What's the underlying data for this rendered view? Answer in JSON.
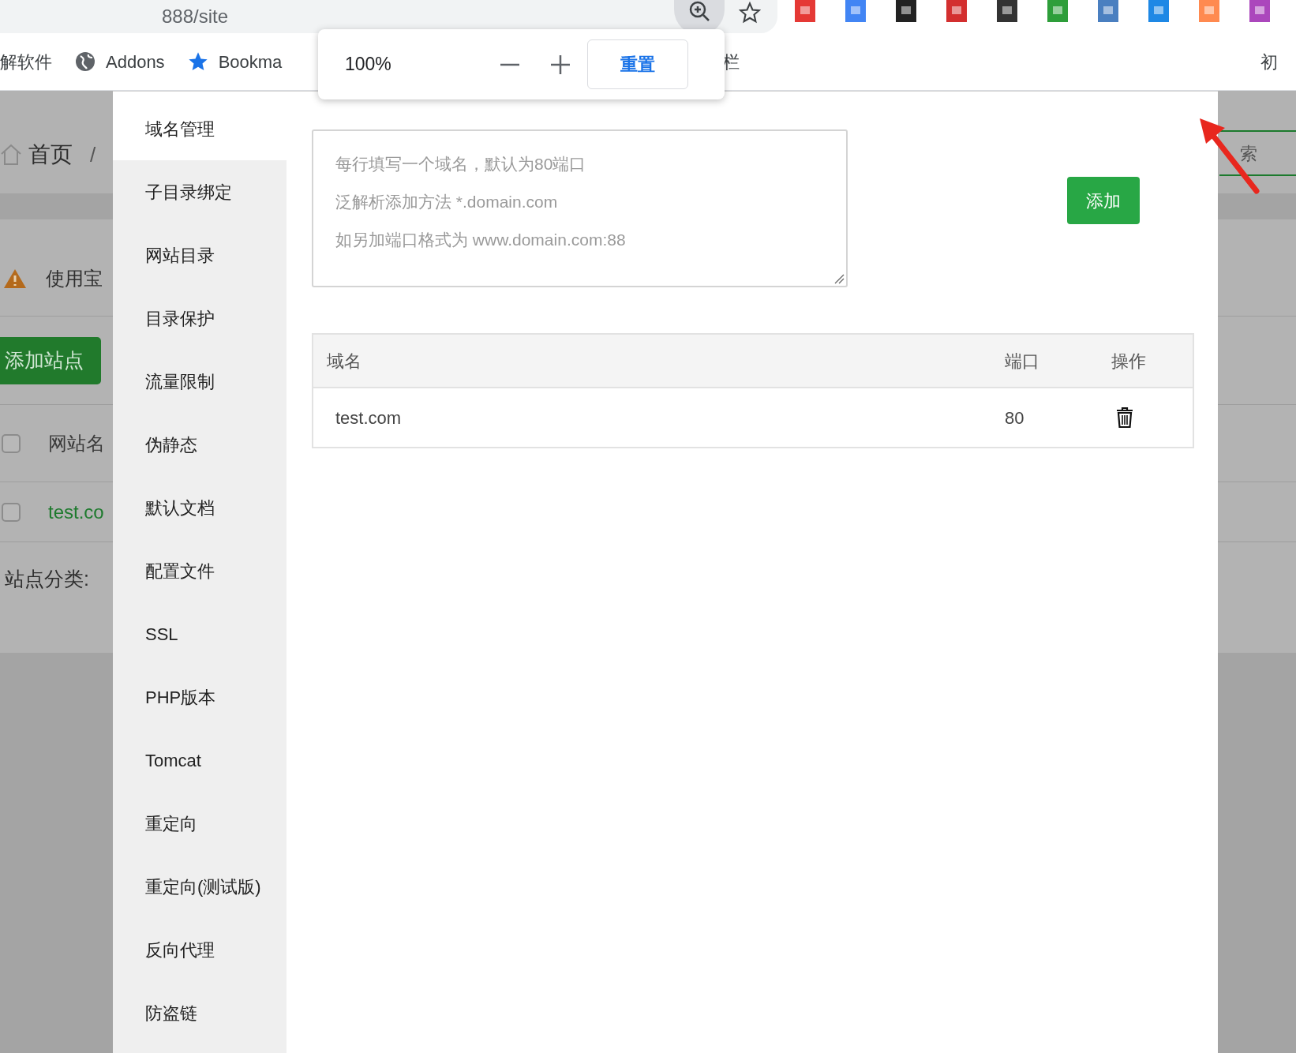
{
  "browser": {
    "address": "888/site",
    "bookmarks": [
      {
        "label": "解软件",
        "kind": "plain"
      },
      {
        "label": "Addons",
        "kind": "globe"
      },
      {
        "label": "Bookma",
        "kind": "star"
      },
      {
        "label": "栏",
        "kind": "plain"
      },
      {
        "label": "初",
        "kind": "plain"
      }
    ]
  },
  "zoom_popup": {
    "value": "100%",
    "reset_button": "重置"
  },
  "background_page": {
    "breadcrumb_home": "首页",
    "breadcrumb_separator": "/",
    "search": "索",
    "warning": "使用宝",
    "add_site_button": "添加站点",
    "table_header": {
      "label": "网站名",
      "checked": false
    },
    "row": {
      "label": "test.co",
      "checked": false
    },
    "category_label": "站点分类:"
  },
  "modal": {
    "menu": [
      {
        "label": "域名管理",
        "selected": true
      },
      {
        "label": "子目录绑定",
        "selected": false
      },
      {
        "label": "网站目录",
        "selected": false
      },
      {
        "label": "目录保护",
        "selected": false
      },
      {
        "label": "流量限制",
        "selected": false
      },
      {
        "label": "伪静态",
        "selected": false
      },
      {
        "label": "默认文档",
        "selected": false
      },
      {
        "label": "配置文件",
        "selected": false
      },
      {
        "label": "SSL",
        "selected": false
      },
      {
        "label": "PHP版本",
        "selected": false
      },
      {
        "label": "Tomcat",
        "selected": false
      },
      {
        "label": "重定向",
        "selected": false
      },
      {
        "label": "重定向(测试版)",
        "selected": false
      },
      {
        "label": "反向代理",
        "selected": false
      },
      {
        "label": "防盗链",
        "selected": false
      }
    ],
    "domain_input": {
      "placeholder": [
        "每行填写一个域名，默认为80端口",
        "泛解析添加方法 *.domain.com",
        "如另加端口格式为 www.domain.com:88"
      ]
    },
    "add_button": "添加",
    "table": {
      "columns": [
        "域名",
        "端口",
        "操作"
      ],
      "rows": [
        {
          "domain": "test.com",
          "port": "80"
        }
      ]
    }
  }
}
